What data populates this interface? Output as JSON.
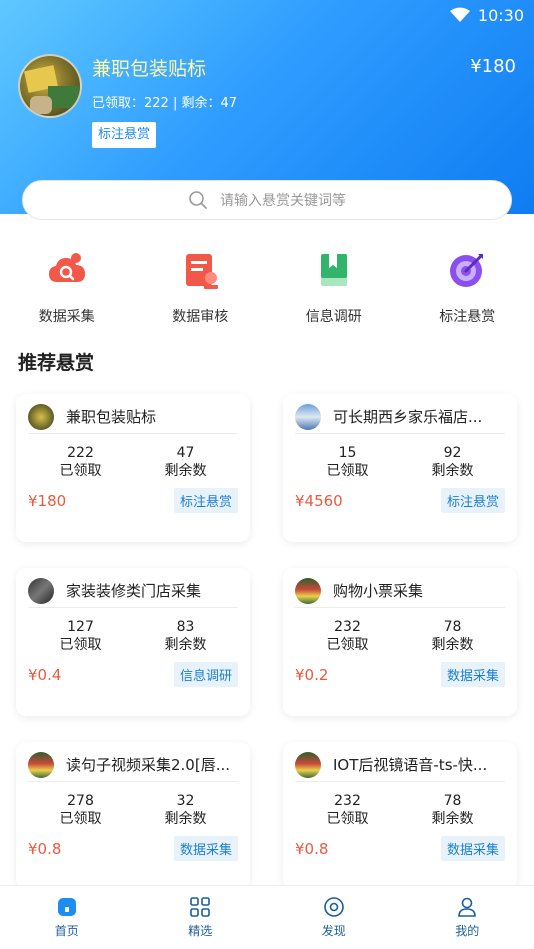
{
  "status_bar": {
    "time": "10:30"
  },
  "banner": {
    "title": "兼职包装贴标",
    "price": "¥180",
    "stats": "已领取：222 | 剩余：47",
    "tag": "标注悬赏"
  },
  "search": {
    "placeholder": "请输入悬赏关键词等"
  },
  "quick_actions": [
    {
      "label": "数据采集",
      "icon": "cloud-search-icon"
    },
    {
      "label": "数据审核",
      "icon": "document-review-icon"
    },
    {
      "label": "信息调研",
      "icon": "bookmark-book-icon"
    },
    {
      "label": "标注悬赏",
      "icon": "target-icon"
    }
  ],
  "section_title": "推荐悬赏",
  "stat_labels": {
    "claimed": "已领取",
    "remaining": "剩余数"
  },
  "cards": [
    {
      "title": "兼职包装贴标",
      "claimed": "222",
      "remaining": "47",
      "price": "¥180",
      "tag": "标注悬赏"
    },
    {
      "title": "可长期西乡家乐福店...",
      "claimed": "15",
      "remaining": "92",
      "price": "¥4560",
      "tag": "标注悬赏"
    },
    {
      "title": "家装装修类门店采集",
      "claimed": "127",
      "remaining": "83",
      "price": "¥0.4",
      "tag": "信息调研"
    },
    {
      "title": "购物小票采集",
      "claimed": "232",
      "remaining": "78",
      "price": "¥0.2",
      "tag": "数据采集"
    },
    {
      "title": "读句子视频采集2.0[唇...",
      "claimed": "278",
      "remaining": "32",
      "price": "¥0.8",
      "tag": "数据采集"
    },
    {
      "title": "IOT后视镜语音-ts-快...",
      "claimed": "232",
      "remaining": "78",
      "price": "¥0.8",
      "tag": "数据采集"
    }
  ],
  "tabbar": [
    {
      "label": "首页",
      "icon": "home-icon"
    },
    {
      "label": "精选",
      "icon": "grid-icon"
    },
    {
      "label": "发现",
      "icon": "compass-icon"
    },
    {
      "label": "我的",
      "icon": "user-icon"
    }
  ],
  "colors": {
    "accent": "#1d8df0",
    "price": "#e95b3f",
    "tag_bg": "#e8f2fb"
  }
}
